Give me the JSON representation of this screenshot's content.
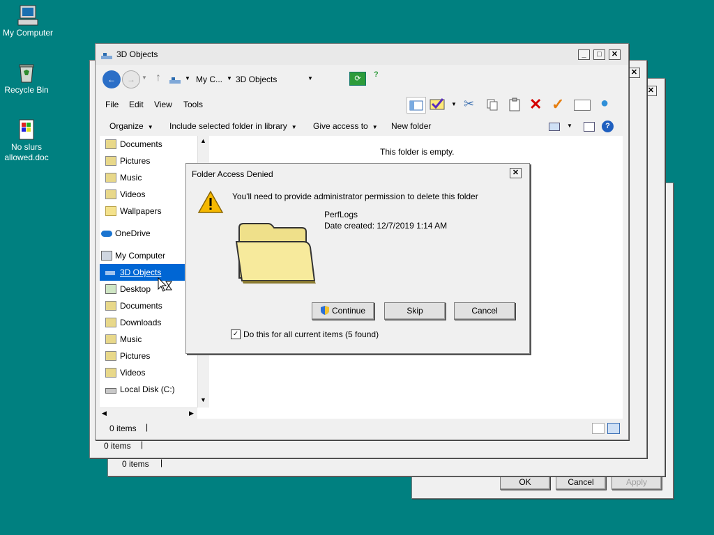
{
  "desktop": {
    "icons": [
      {
        "label": "My Computer",
        "icon": "computer-icon"
      },
      {
        "label": "Recycle Bin",
        "icon": "recycle-bin-icon"
      },
      {
        "label": "No slurs allowed.doc",
        "icon": "document-icon"
      }
    ]
  },
  "back_windows": {
    "status_items_1": "0 items",
    "status_items_2": "0 items",
    "ok": "OK",
    "cancel": "Cancel",
    "apply": "Apply"
  },
  "explorer": {
    "title": "3D Objects",
    "address": {
      "crumb1": "My C...",
      "crumb2": "3D Objects"
    },
    "menu": [
      "File",
      "Edit",
      "View",
      "Tools"
    ],
    "commands": {
      "organize": "Organize",
      "include": "Include selected folder in library",
      "share": "Give access to",
      "new_folder": "New folder"
    },
    "empty_text": "This folder is empty.",
    "nav": [
      {
        "label": "Documents",
        "icon": "documents-folder-icon"
      },
      {
        "label": "Pictures",
        "icon": "pictures-folder-icon"
      },
      {
        "label": "Music",
        "icon": "music-folder-icon"
      },
      {
        "label": "Videos",
        "icon": "videos-folder-icon"
      },
      {
        "label": "Wallpapers",
        "icon": "folder-icon"
      },
      {
        "label": "OneDrive",
        "icon": "onedrive-icon"
      },
      {
        "label": "My Computer",
        "icon": "computer-icon"
      },
      {
        "label": "3D Objects",
        "icon": "3d-objects-icon"
      },
      {
        "label": "Desktop",
        "icon": "desktop-folder-icon"
      },
      {
        "label": "Documents",
        "icon": "documents-folder-icon"
      },
      {
        "label": "Downloads",
        "icon": "downloads-folder-icon"
      },
      {
        "label": "Music",
        "icon": "music-folder-icon"
      },
      {
        "label": "Pictures",
        "icon": "pictures-folder-icon"
      },
      {
        "label": "Videos",
        "icon": "videos-folder-icon"
      },
      {
        "label": "Local Disk (C:)",
        "icon": "drive-icon"
      }
    ],
    "status": "0 items"
  },
  "dialog": {
    "title": "Folder Access Denied",
    "message": "You'll need to provide administrator permission to delete this folder",
    "folder_name": "PerfLogs",
    "date_created": "Date created: 12/7/2019 1:14 AM",
    "continue": "Continue",
    "skip": "Skip",
    "cancel": "Cancel",
    "checkbox_label": "Do this for all current items (5 found)",
    "checkbox_checked": true
  },
  "colors": {
    "desktop": "#008080",
    "selection": "#0066d4",
    "warning": "#f5b800"
  }
}
